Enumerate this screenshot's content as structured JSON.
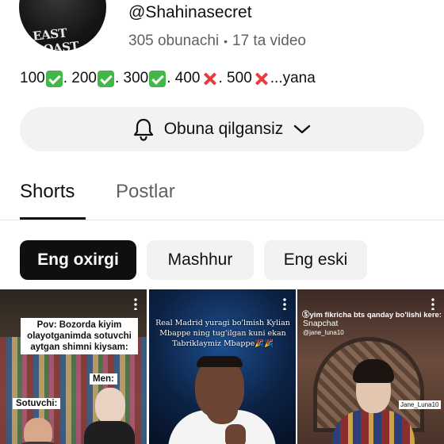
{
  "channel": {
    "avatar_text": "EAST COAST",
    "handle": "@Shahinasecret",
    "subscribers": "305 obunachi",
    "separator": "•",
    "videos": "17 ta video"
  },
  "description": {
    "parts": [
      "100",
      ". 200",
      ". 300",
      ". 400",
      ". 500",
      " ...yana"
    ],
    "emojis": [
      "check-mark",
      "check-mark",
      "check-mark",
      "cross-mark",
      "cross-mark"
    ]
  },
  "subscribe": {
    "label": "Obuna qilgansiz",
    "icon": "bell-icon",
    "chevron": "chevron-down-icon"
  },
  "tabs": [
    {
      "label": "Shorts",
      "active": true
    },
    {
      "label": "Postlar",
      "active": false
    }
  ],
  "filters": [
    {
      "label": "Eng oxirgi",
      "selected": true
    },
    {
      "label": "Mashhur",
      "selected": false
    },
    {
      "label": "Eng eski",
      "selected": false
    }
  ],
  "shorts": [
    {
      "caption": "Pov: Bozorda kiyim olayotganimda sotuvchi aytgan shimni kiysam:",
      "label_men": "Men:",
      "label_seller": "Sotuvchi:"
    },
    {
      "caption": "Real Madrid yuragi bo'lmish Kylian Mbappe ning tug'ilgan kuni ekan Tabriklaymiz Mbappe🎉🎉"
    },
    {
      "caption": "Ⓢyim fikricha bts qanday bo'lishi kere:",
      "snap_title": "Snapchat",
      "snap_user": "@jane_luna10",
      "tag": "Jane_Luna10"
    }
  ],
  "colors": {
    "text_primary": "#0f0f0f",
    "text_secondary": "#606060",
    "chip_bg": "#f2f2f2",
    "chip_selected_bg": "#0f0f0f",
    "check_green": "#44b749",
    "cross_red": "#e83b3b"
  }
}
